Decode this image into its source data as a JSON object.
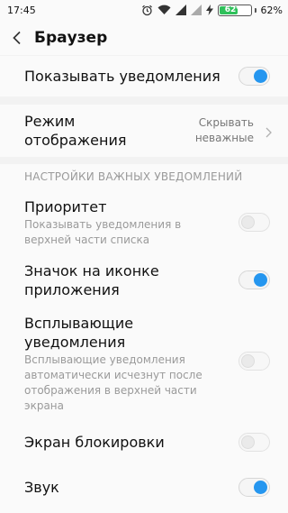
{
  "status": {
    "time": "17:45",
    "battery_percent": "62%",
    "battery_level": 0.62,
    "icons": [
      "alarm-icon",
      "wifi-icon",
      "signal-icon",
      "signal-icon",
      "charging-icon"
    ]
  },
  "header": {
    "title": "Браузер"
  },
  "show_notifications": {
    "label": "Показывать уведомления",
    "enabled": true
  },
  "display_mode": {
    "label_line1": "Режим",
    "label_line2": "отображения",
    "value_line1": "Скрывать",
    "value_line2": "неважные"
  },
  "important_section": {
    "header": "НАСТРОЙКИ ВАЖНЫХ УВЕДОМЛЕНИЙ",
    "items": [
      {
        "title": "Приоритет",
        "subtitle_line1": "Показывать уведомления в",
        "subtitle_line2": "верхней части списка",
        "enabled": false
      },
      {
        "title_line1": "Значок на иконке",
        "title_line2": "приложения",
        "enabled": true
      },
      {
        "title_line1": "Всплывающие",
        "title_line2": "уведомления",
        "subtitle_line1": "Всплывающие уведомления",
        "subtitle_line2": "автоматически исчезнут после",
        "subtitle_line3": "отображения в верхней части",
        "subtitle_line4": "экрана",
        "enabled": false
      },
      {
        "title": "Экран блокировки",
        "enabled": false
      },
      {
        "title": "Звук",
        "enabled": true
      }
    ]
  },
  "colors": {
    "accent": "#2596ef",
    "battery_green": "#2ec05a",
    "background": "#f2f2f2",
    "card": "#fafafa",
    "secondary_text": "#9a9a9a"
  }
}
